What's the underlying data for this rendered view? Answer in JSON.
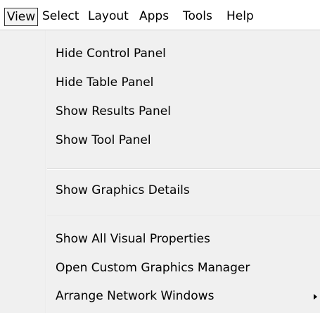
{
  "menubar": {
    "items": [
      {
        "label": "View",
        "active": true
      },
      {
        "label": "Select"
      },
      {
        "label": "Layout"
      },
      {
        "label": "Apps"
      },
      {
        "label": "Tools"
      },
      {
        "label": "Help"
      }
    ]
  },
  "menu": {
    "groups": [
      {
        "items": [
          {
            "label": "Hide Control Panel"
          },
          {
            "label": "Hide Table Panel"
          },
          {
            "label": "Show Results Panel"
          },
          {
            "label": "Show Tool Panel"
          }
        ]
      },
      {
        "items": [
          {
            "label": "Show Graphics Details"
          }
        ]
      },
      {
        "items": [
          {
            "label": "Show All Visual Properties"
          },
          {
            "label": "Open Custom Graphics Manager"
          },
          {
            "label": "Arrange Network Windows",
            "submenu": true
          }
        ]
      }
    ]
  },
  "colors": {
    "menu_background": "#f0f0f0",
    "separator": "#d6d6d6",
    "active_border": "#333333"
  }
}
